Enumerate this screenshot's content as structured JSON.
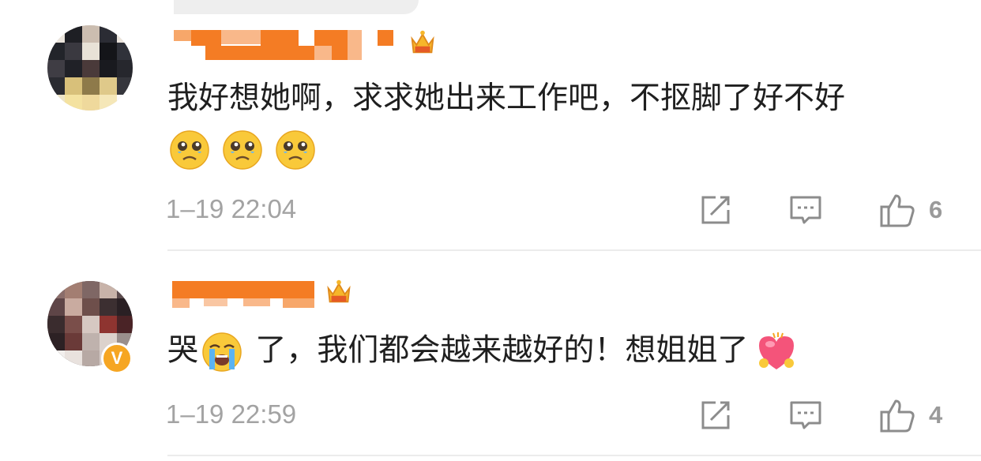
{
  "comments": [
    {
      "text": "我好想她啊，求求她出来工作吧，不抠脚了好不好",
      "emojis": [
        "crying-face-icon",
        "crying-face-icon",
        "crying-face-icon"
      ],
      "timestamp": "1–19 22:04",
      "likes": "6",
      "username_obscured": true,
      "badge": "crown-icon"
    },
    {
      "text_part1": "哭",
      "inline_emoji": "loudly-crying-face-icon",
      "text_part2": " 了，我们都会越来越好的！想姐姐了",
      "trailing_emoji": "heart-hug-icon",
      "timestamp": "1–19 22:59",
      "likes": "4",
      "username_obscured": true,
      "badge": "crown-icon",
      "verified": "V"
    }
  ],
  "colors": {
    "redaction": "#f47c24",
    "timestamp": "#a3a3a3",
    "divider": "#ececec",
    "verified": "#f6a623"
  }
}
